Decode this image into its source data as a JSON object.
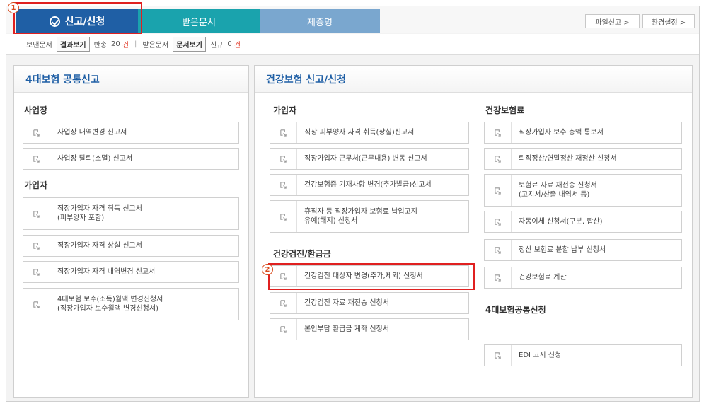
{
  "tabs": {
    "active_label": "신고/신청",
    "received_label": "받은문서",
    "cert_label": "제증명",
    "file_report_label": "파일신고 >",
    "settings_label": "환경설정 >"
  },
  "markers": {
    "one": "1",
    "two": "2"
  },
  "status": {
    "sent_label": "보낸문서",
    "result_btn": "결과보기",
    "returned_label": "반송",
    "returned_count": "20",
    "unit": "건",
    "sep": "|",
    "received_label": "받은문서",
    "view_btn": "문서보기",
    "new_label": "신규",
    "new_count": "0"
  },
  "left_panel": {
    "title": "4대보험 공통신고",
    "workplace": {
      "title": "사업장",
      "items": [
        "사업장 내역변경 신고서",
        "사업장 탈퇴(소멸) 신고서"
      ]
    },
    "subscriber": {
      "title": "가입자",
      "items": [
        [
          "직장가입자 자격 취득 신고서",
          "(피부양자 포함)"
        ],
        [
          "직장가입자 자격 상실 신고서"
        ],
        [
          "직장가입자 자격 내역변경 신고서"
        ],
        [
          "4대보험 보수(소득)월액 변경신청서",
          "(직장가입자 보수월액 변경신청서)"
        ]
      ]
    }
  },
  "right_panel": {
    "title": "건강보험 신고/신청",
    "subscriber": {
      "title": "가입자",
      "items": [
        [
          "직장 피부양자 자격 취득(상실)신고서"
        ],
        [
          "직장가입자 근무처(근무내용) 변동 신고서"
        ],
        [
          "건강보험증 기재사항 변경(추가발급)신고서"
        ],
        [
          "휴직자 등 직장가입자 보험료 납입고지",
          "유예(해지) 신청서"
        ]
      ]
    },
    "checkup": {
      "title": "건강검진/환급금",
      "items": [
        [
          "건강검진 대상자 변경(추가,제외) 신청서"
        ],
        [
          "건강검진 자료 재전송 신청서"
        ],
        [
          "본인부담 환급금 계좌 신청서"
        ]
      ]
    },
    "premium": {
      "title": "건강보험료",
      "items": [
        [
          "직장가입자 보수 총액 통보서"
        ],
        [
          "퇴직정산/연말정산 재정산 신청서"
        ],
        [
          "보험료 자료 재전송 신청서",
          "(고지서/산출 내역서 등)"
        ],
        [
          "자동이체 신청서(구분, 합산)"
        ],
        [
          "정산 보험료 분할 납부 신청서"
        ],
        [
          "건강보험료 계산"
        ]
      ]
    },
    "common": {
      "title": "4대보험공통신청",
      "items": [
        [
          "EDI 고지 신청"
        ]
      ]
    }
  }
}
